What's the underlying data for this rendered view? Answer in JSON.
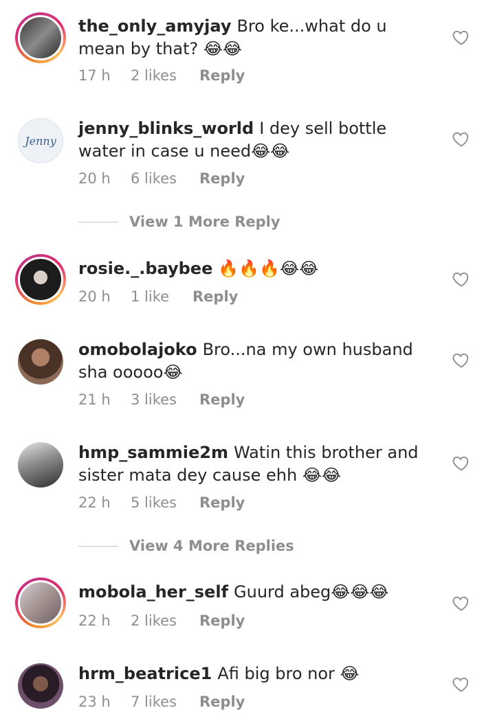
{
  "comments": [
    {
      "username": "the_only_amyjay",
      "text": "Bro ke...what do u mean by that? 😂😂",
      "time": "17 h",
      "likes": "2 likes",
      "reply": "Reply",
      "ring": true,
      "avatar_color": "#5a5a5a"
    },
    {
      "username": "jenny_blinks_world",
      "text": "I dey sell bottle water in case u need😂😂",
      "time": "20 h",
      "likes": "6 likes",
      "reply": "Reply",
      "ring": false,
      "avatar_color": "#e8eef5"
    },
    {
      "username": "rosie._.baybee",
      "text": "🔥🔥🔥😂😂",
      "time": "20 h",
      "likes": "1 like",
      "reply": "Reply",
      "ring": true,
      "avatar_color": "#1c1c1c"
    },
    {
      "username": "omobolajoko",
      "text": "Bro...na my own husband sha ooooo😂",
      "time": "21 h",
      "likes": "3 likes",
      "reply": "Reply",
      "ring": false,
      "avatar_color": "#7a5a48"
    },
    {
      "username": "hmp_sammie2m",
      "text": "Watin this brother and sister mata dey cause ehh 😂😂",
      "time": "22 h",
      "likes": "5 likes",
      "reply": "Reply",
      "ring": false,
      "avatar_color": "#6e6e6e"
    },
    {
      "username": "mobola_her_self",
      "text": "Guurd abeg😂😂😂",
      "time": "22 h",
      "likes": "2 likes",
      "reply": "Reply",
      "ring": true,
      "avatar_color": "#b8a6a0"
    },
    {
      "username": "hrm_beatrice1",
      "text": "Afi big bro nor 😂",
      "time": "23 h",
      "likes": "7 likes",
      "reply": "Reply",
      "ring": false,
      "avatar_color": "#5c3d55"
    }
  ],
  "view_more": [
    {
      "label": "View 1 More Reply"
    },
    {
      "label": "View 4 More Replies"
    }
  ]
}
